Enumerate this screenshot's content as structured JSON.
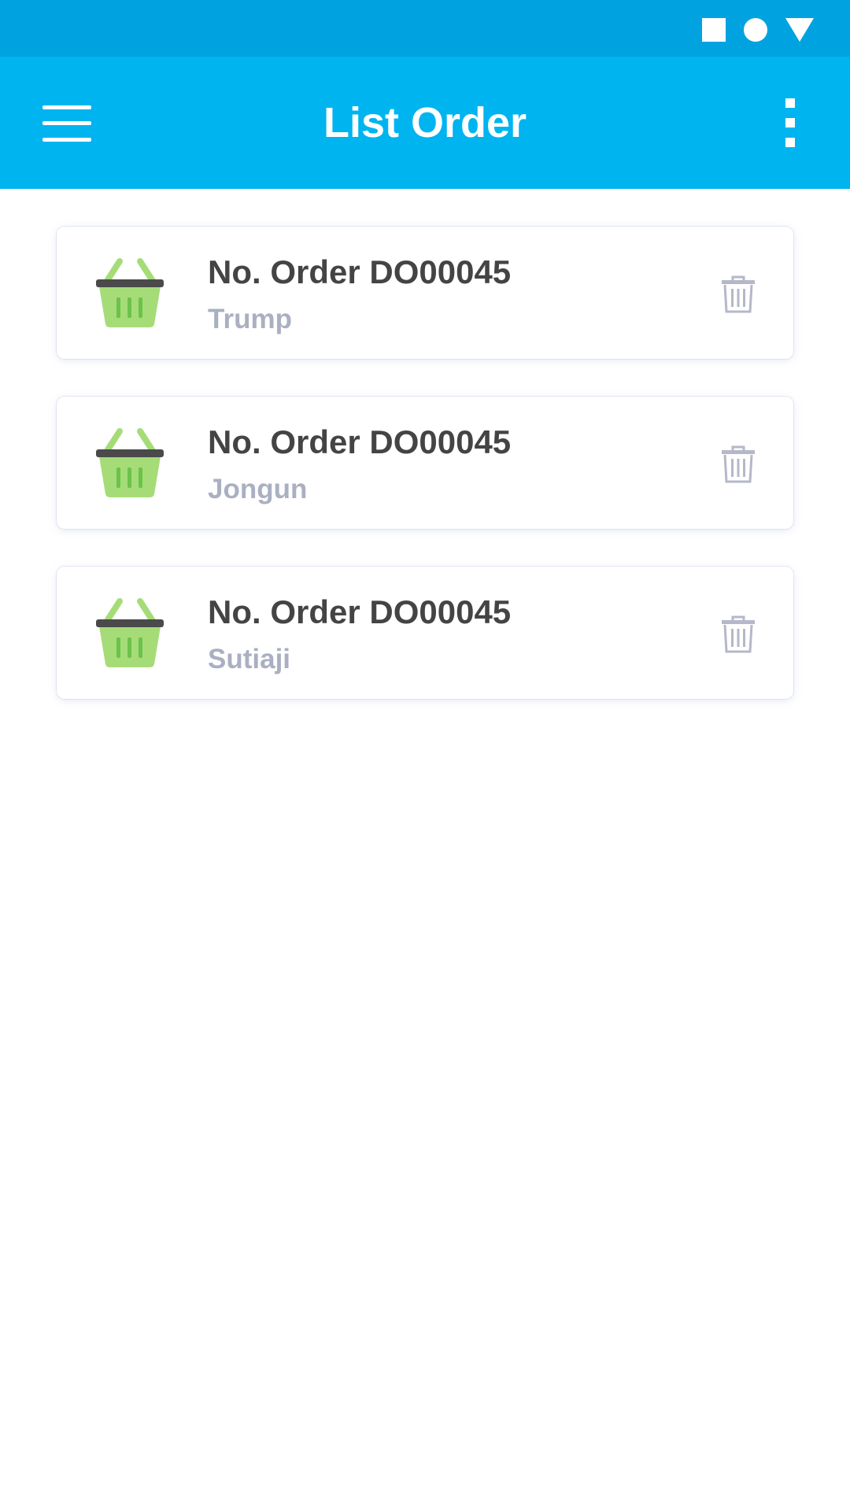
{
  "app": {
    "title": "List Order"
  },
  "status_bar": {
    "icons": [
      "square-icon",
      "circle-icon",
      "triangle-icon"
    ]
  },
  "toolbar": {
    "menu_icon": "hamburger-menu-icon",
    "more_icon": "more-vertical-icon"
  },
  "orders": [
    {
      "order_no": "No. Order DO00045",
      "customer": "Trump"
    },
    {
      "order_no": "No. Order DO00045",
      "customer": "Jongun"
    },
    {
      "order_no": "No. Order DO00045",
      "customer": "Sutiaji"
    }
  ],
  "colors": {
    "status_bar": "#00a3e0",
    "app_bar": "#00b4f0",
    "title_text": "#ffffff",
    "order_text": "#444444",
    "customer_text": "#aab0c2",
    "basket_green": "#a5dc78",
    "basket_dark": "#4a4a4a",
    "trash_icon": "#b4b8c8"
  }
}
